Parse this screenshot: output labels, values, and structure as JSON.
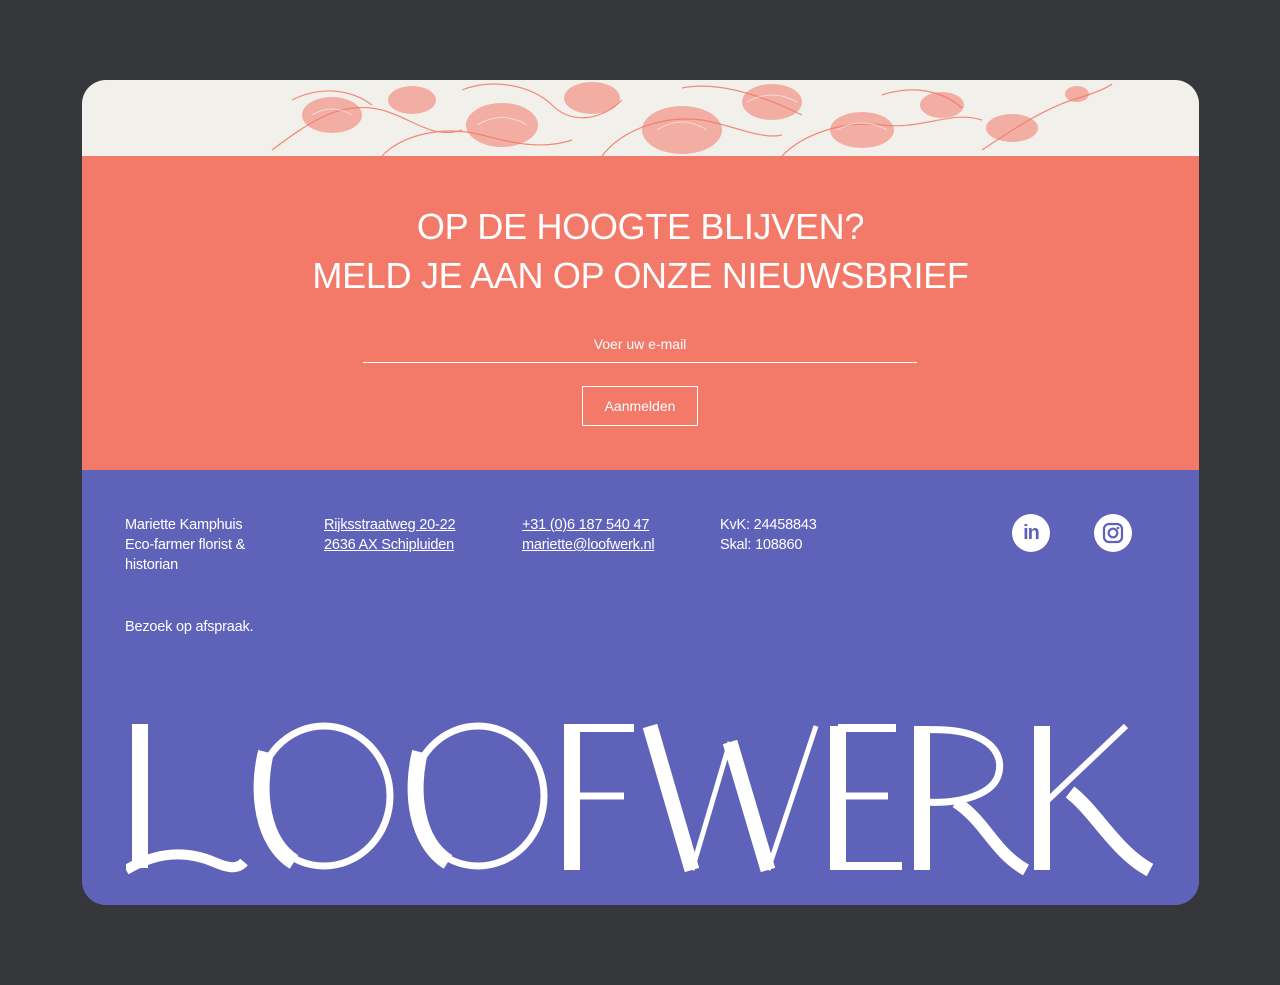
{
  "newsletter": {
    "heading_line1": "OP DE HOOGTE BLIJVEN?",
    "heading_line2": "MELD JE AAN OP ONZE NIEUWSBRIEF",
    "email_placeholder": "Voer uw e-mail",
    "submit_label": "Aanmelden"
  },
  "footer": {
    "name": "Mariette Kamphuis",
    "role_line1": "Eco-farmer florist &",
    "role_line2": "historian",
    "address_line1": "Rijksstraatweg 20-22",
    "address_line2": "2636 AX Schipluiden",
    "phone": "+31 (0)6 187 540 47",
    "email": "mariette@loofwerk.nl",
    "kvk": "KvK: 24458843",
    "skal": "Skal: 108860",
    "visit_note": "Bezoek op afspraak.",
    "social": [
      {
        "name": "linkedin",
        "icon": "linkedin-icon",
        "glyph": "in"
      },
      {
        "name": "instagram",
        "icon": "instagram-icon"
      }
    ]
  },
  "brand": {
    "wordmark": "LOOFWERK"
  },
  "colors": {
    "page_background": "#35373b",
    "floral_background": "#f2f0ea",
    "coral": "#f37968",
    "purple": "#5f62b9",
    "text": "#ffffff"
  }
}
